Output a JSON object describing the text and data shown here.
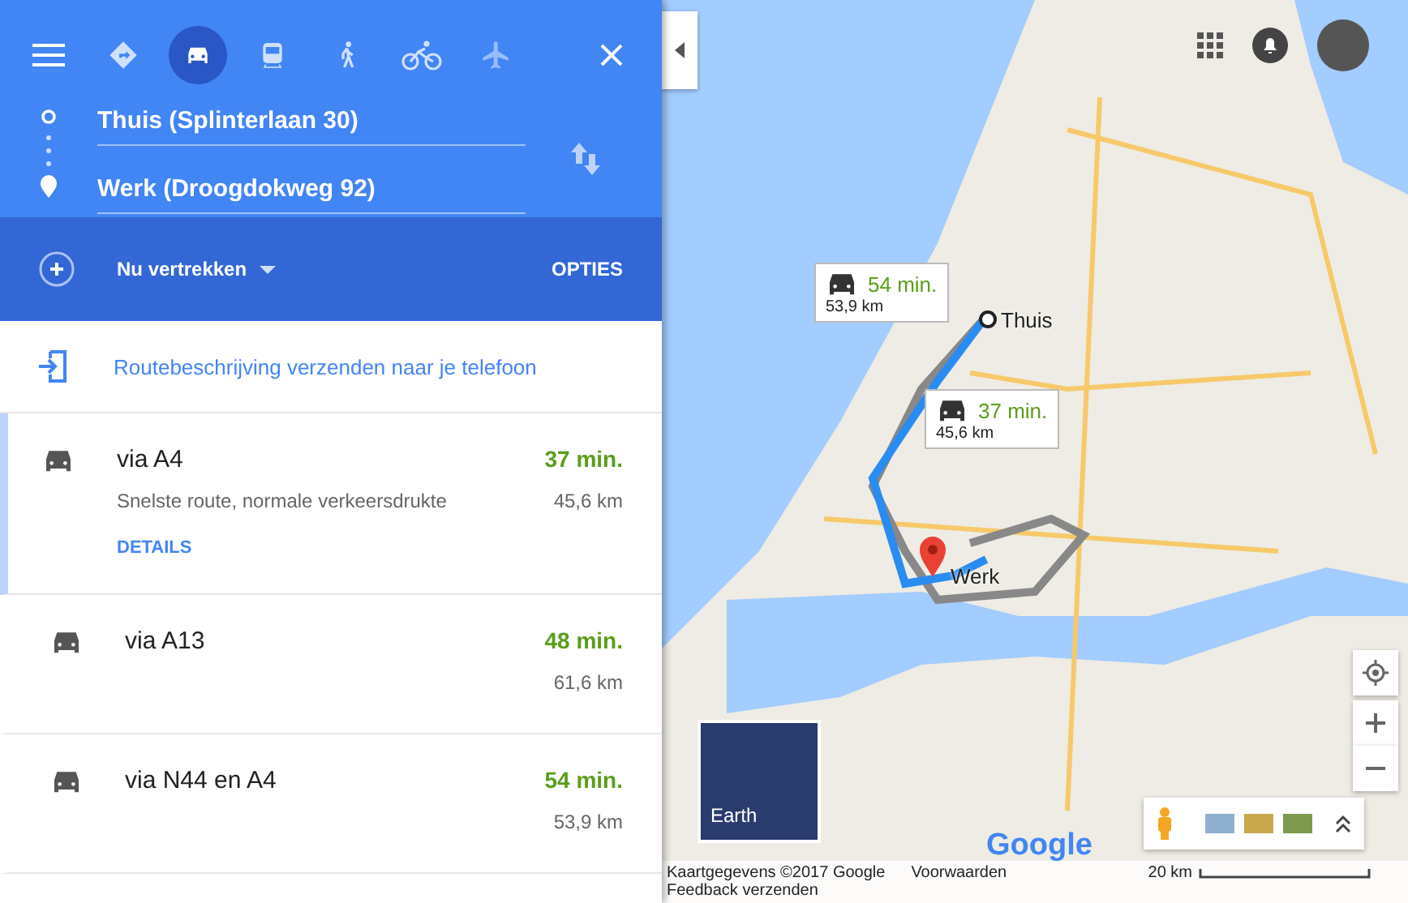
{
  "travel_modes": [
    {
      "kind": "best",
      "selected": false
    },
    {
      "kind": "car",
      "selected": true
    },
    {
      "kind": "transit",
      "selected": false
    },
    {
      "kind": "walk",
      "selected": false
    },
    {
      "kind": "bike",
      "selected": false
    },
    {
      "kind": "plane",
      "selected": false
    }
  ],
  "origin": {
    "value": "Thuis (Splinterlaan 30)"
  },
  "destination": {
    "value": "Werk (Droogdokweg 92)"
  },
  "departure": {
    "label": "Nu vertrekken",
    "options_button": "OPTIES"
  },
  "send_link": "Routebeschrijving verzenden naar je telefoon",
  "routes": [
    {
      "name": "via A4",
      "time": "37 min.",
      "distance": "45,6 km",
      "description": "Snelste route, normale verkeersdrukte",
      "details": "DETAILS",
      "selected": true
    },
    {
      "name": "via A13",
      "time": "48 min.",
      "distance": "61,6 km",
      "selected": false
    },
    {
      "name": "via N44 en A4",
      "time": "54 min.",
      "distance": "53,9 km",
      "selected": false
    }
  ],
  "map": {
    "callouts": [
      {
        "time": "54 min.",
        "distance": "53,9 km"
      },
      {
        "time": "37 min.",
        "distance": "45,6 km"
      }
    ],
    "start_label": "Thuis",
    "end_label": "Werk",
    "earth_label": "Earth",
    "logo": "Google",
    "footer": {
      "copyright": "Kaartgegevens ©2017 Google",
      "terms": "Voorwaarden",
      "feedback": "Feedback verzenden",
      "scale": "20 km"
    }
  }
}
